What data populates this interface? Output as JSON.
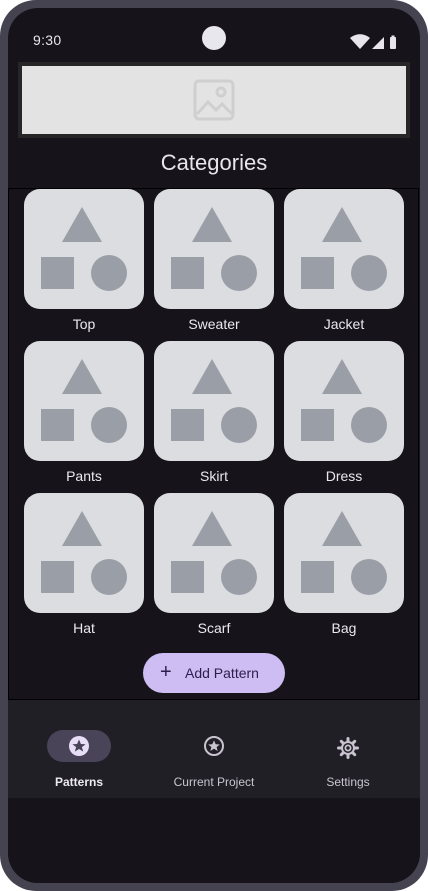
{
  "status_bar": {
    "time": "9:30"
  },
  "ad_banner": {
    "icon": "image-placeholder-icon"
  },
  "header": {
    "title": "Categories"
  },
  "categories": [
    {
      "label": "Top",
      "icon": "shapes-placeholder-icon"
    },
    {
      "label": "Sweater",
      "icon": "shapes-placeholder-icon"
    },
    {
      "label": "Jacket",
      "icon": "shapes-placeholder-icon"
    },
    {
      "label": "Pants",
      "icon": "shapes-placeholder-icon"
    },
    {
      "label": "Skirt",
      "icon": "shapes-placeholder-icon"
    },
    {
      "label": "Dress",
      "icon": "shapes-placeholder-icon"
    },
    {
      "label": "Hat",
      "icon": "shapes-placeholder-icon"
    },
    {
      "label": "Scarf",
      "icon": "shapes-placeholder-icon"
    },
    {
      "label": "Bag",
      "icon": "shapes-placeholder-icon"
    }
  ],
  "add_button": {
    "label": "Add Pattern",
    "icon": "plus-icon"
  },
  "nav": {
    "items": [
      {
        "label": "Patterns",
        "icon": "star-circle-icon",
        "active": true
      },
      {
        "label": "Current Project",
        "icon": "star-circle-icon",
        "active": false
      },
      {
        "label": "Settings",
        "icon": "gear-icon",
        "active": false
      }
    ]
  },
  "colors": {
    "background": "#16141a",
    "accent": "#cdbdf2",
    "nav_background": "#211f26",
    "nav_active_pill": "#4a4458",
    "thumbnail": "#dcdde1",
    "placeholder_shape": "#9a9ea6"
  }
}
